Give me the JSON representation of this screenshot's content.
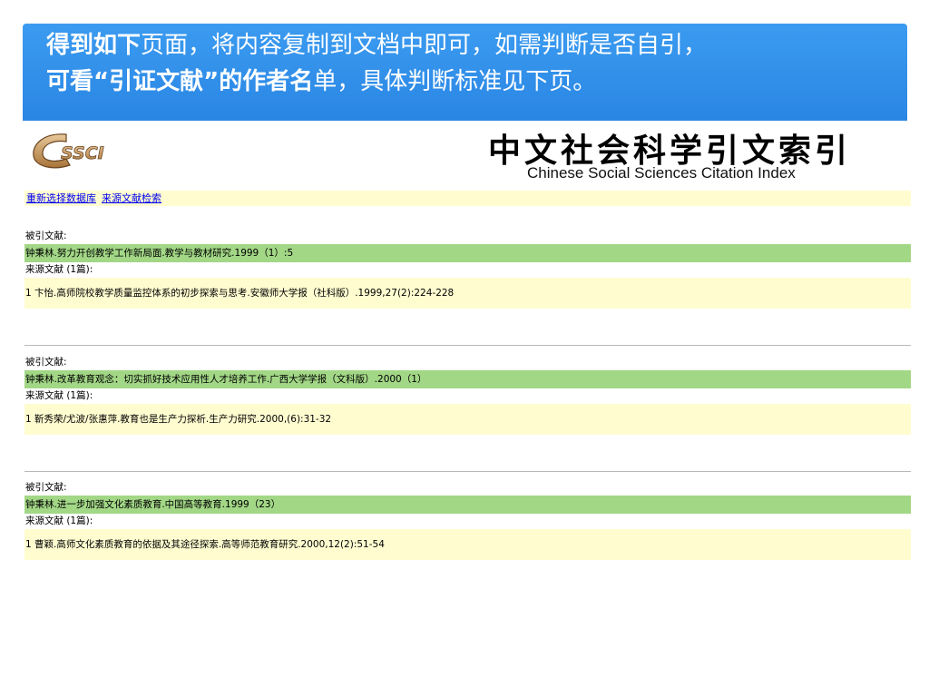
{
  "banner": {
    "line1_bold": "得到如下",
    "line1_rest": "页面，将内容复制到文档中即可，如需判断是否自引，",
    "line2_pre": "可看",
    "line2_quoted": "“引证文献”",
    "line2_bold": "的作者名",
    "line2_rest": "单，具体判断标准见下页。"
  },
  "header": {
    "logo_text": "CSSCI",
    "cn_title": "中文社会科学引文索引",
    "en_title": "Chinese Social Sciences Citation Index"
  },
  "nav": {
    "link1": "重新选择数据库",
    "link2": "来源文献检索"
  },
  "records": [
    {
      "cited_label": "被引文献:",
      "cited": "钟秉林.努力开创教学工作新局面.教学与教材研究.1999（1）:5",
      "source_label": "来源文献 (1篇):",
      "source": "1 卞怡.高师院校教学质量监控体系的初步探索与思考.安徽师大学报（社科版）.1999,27(2):224-228"
    },
    {
      "cited_label": "被引文献:",
      "cited": "钟秉林.改革教育观念：切实抓好技术应用性人才培养工作.广西大学学报（文科版）.2000（1）",
      "source_label": "来源文献 (1篇):",
      "source": "1 靳秀荣/尤波/张惠萍.教育也是生产力探析.生产力研究.2000,(6):31-32"
    },
    {
      "cited_label": "被引文献:",
      "cited": "钟秉林.进一步加强文化素质教育.中国高等教育.1999（23）",
      "source_label": "来源文献 (1篇):",
      "source": "1 曹颖.高师文化素质教育的依据及其途径探索.高等师范教育研究.2000,12(2):51-54"
    }
  ]
}
